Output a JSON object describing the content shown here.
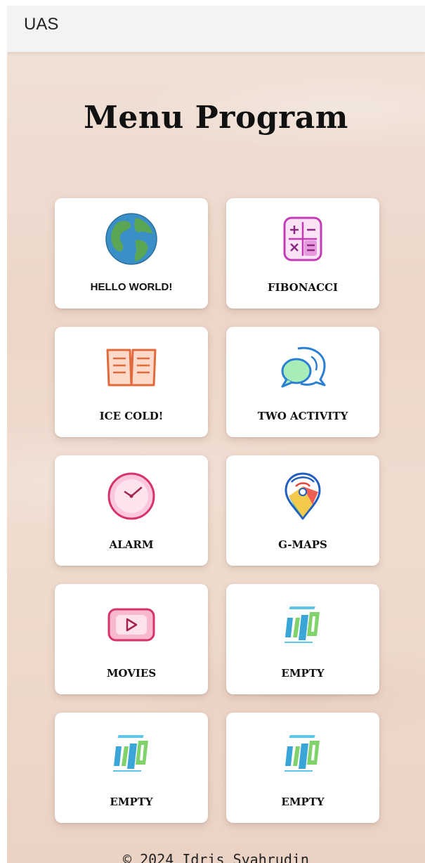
{
  "appbar": {
    "title": "UAS"
  },
  "page": {
    "title": "Menu Program"
  },
  "menu": {
    "items": [
      {
        "label": "HELLO WORLD!",
        "icon": "globe-icon"
      },
      {
        "label": "FIBONACCI",
        "icon": "calculator-icon"
      },
      {
        "label": "ICE COLD!",
        "icon": "open-book-icon"
      },
      {
        "label": "TWO ACTIVITY",
        "icon": "chat-bubbles-icon"
      },
      {
        "label": "ALARM",
        "icon": "clock-icon"
      },
      {
        "label": "G-MAPS",
        "icon": "map-pin-icon"
      },
      {
        "label": "MOVIES",
        "icon": "video-play-icon"
      },
      {
        "label": "EMPTY",
        "icon": "logo-icon"
      },
      {
        "label": "EMPTY",
        "icon": "logo-icon"
      },
      {
        "label": "EMPTY",
        "icon": "logo-icon"
      }
    ]
  },
  "footer": {
    "text": "© 2024 Idris Syahrudin"
  },
  "colors": {
    "appbar": "#f3f3f3",
    "background": "#ecd6c9",
    "card": "#ffffff"
  }
}
